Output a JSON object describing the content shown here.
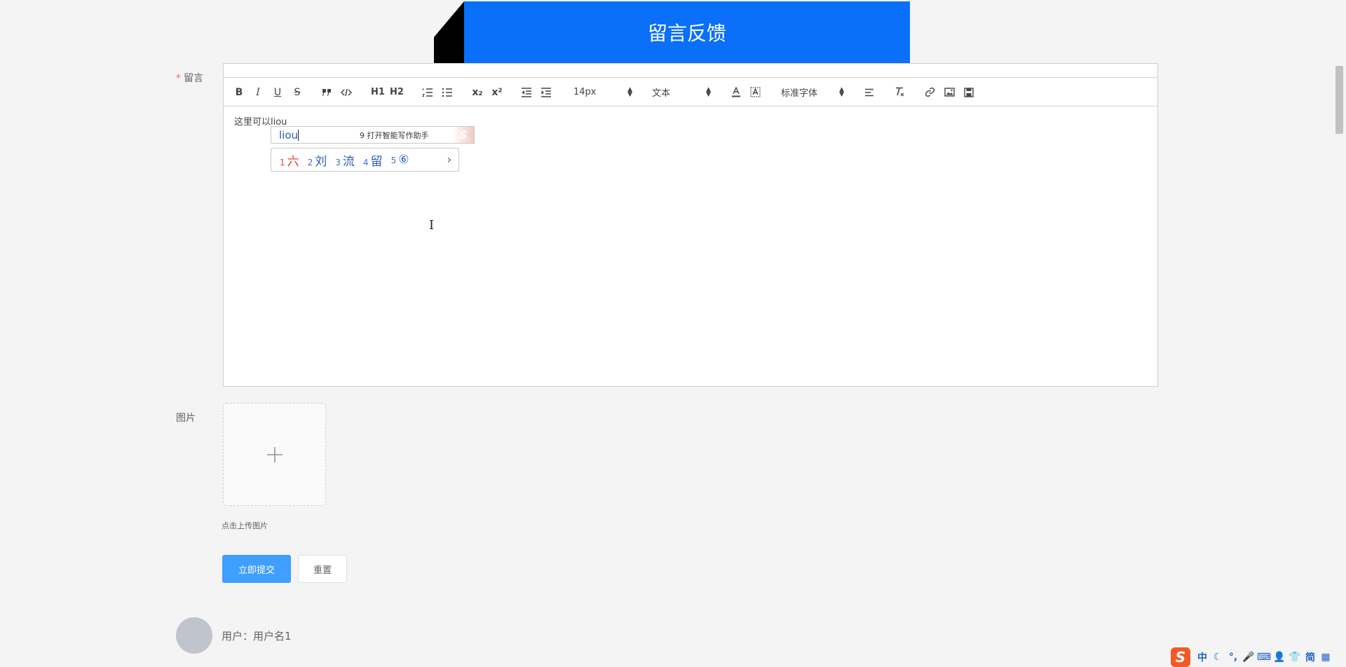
{
  "header": {
    "title": "留言反馈"
  },
  "form": {
    "message_label": "留言",
    "required_mark": "*",
    "image_label": "图片"
  },
  "toolbar": {
    "bold": "B",
    "italic": "I",
    "underline": "U",
    "strike": "S",
    "h1": "H1",
    "h2": "H2",
    "subscript": "x₂",
    "superscript": "x²",
    "size_value": "14px",
    "header_value": "文本",
    "font_value": "标准字体"
  },
  "editor": {
    "content": "这里可以liou"
  },
  "ime": {
    "composition": "liou",
    "assist_text": "9 打开智能写作助手",
    "candidates": [
      {
        "num": "1",
        "char": "六"
      },
      {
        "num": "2",
        "char": "刘"
      },
      {
        "num": "3",
        "char": "流"
      },
      {
        "num": "4",
        "char": "留"
      },
      {
        "num": "5",
        "char": "⑥"
      }
    ],
    "next": "›",
    "logo": "S"
  },
  "upload": {
    "plus": "+",
    "hint": "点击上传图片"
  },
  "buttons": {
    "submit": "立即提交",
    "reset": "重置"
  },
  "user": {
    "label": "用户：",
    "name": "用户名1"
  },
  "ime_status": {
    "logo": "S",
    "items": [
      {
        "name": "lang-zh",
        "text": "中"
      },
      {
        "name": "half-width",
        "text": "☾"
      },
      {
        "name": "punctuation",
        "text": "°,"
      },
      {
        "name": "voice",
        "text": "🎤"
      },
      {
        "name": "keyboard",
        "text": "⌨"
      },
      {
        "name": "account",
        "text": "👤"
      },
      {
        "name": "skin",
        "text": "👕"
      },
      {
        "name": "simplified",
        "text": "简"
      },
      {
        "name": "toolbox",
        "text": "▦"
      }
    ]
  },
  "colors": {
    "banner": "#0a6ff9",
    "primary": "#409eff",
    "required": "#f56c6c",
    "page_bg": "#f4f4f4"
  }
}
